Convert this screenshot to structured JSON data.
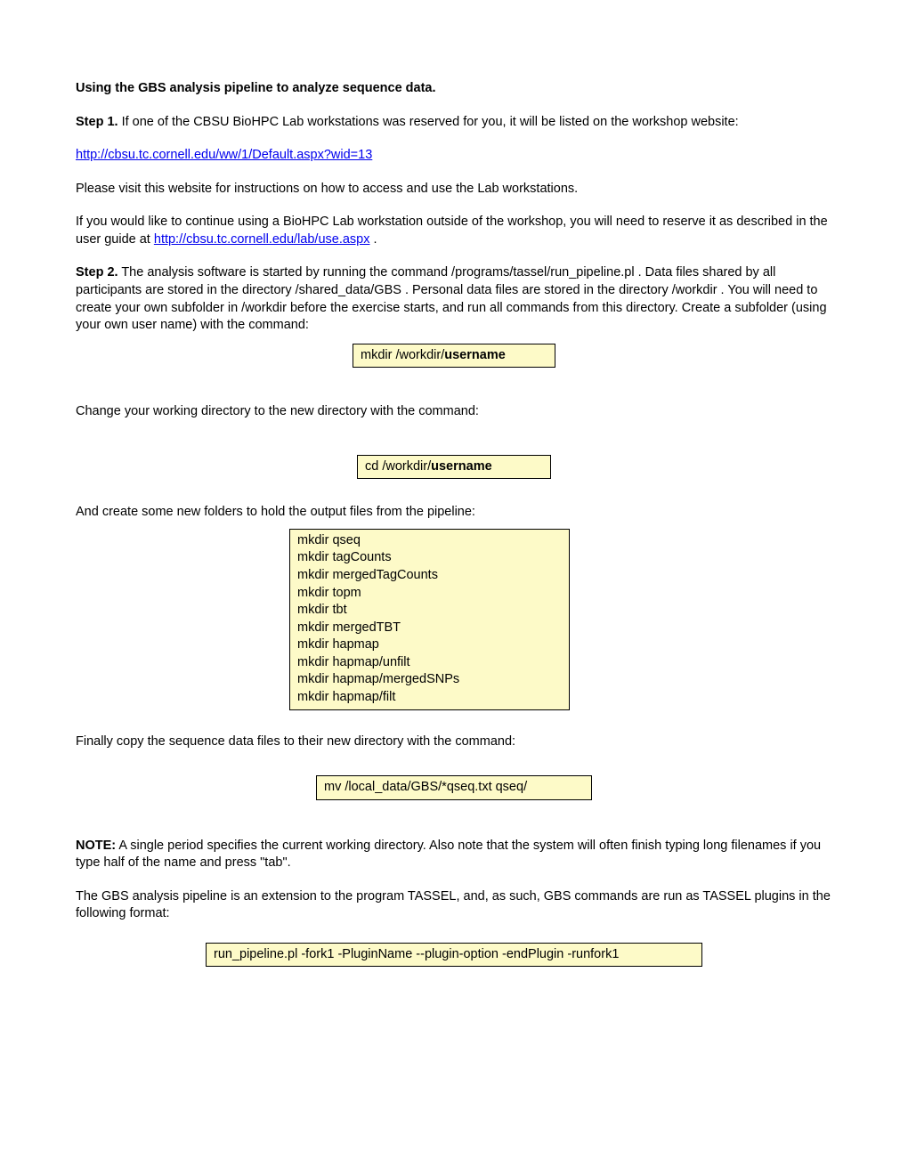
{
  "title": "Using the GBS analysis pipeline to analyze sequence data.",
  "step1_label": "Step 1.",
  "step1_tail": "  If one of the CBSU BioHPC Lab workstations was reserved for you, it will be listed on the workshop website:",
  "link1": "http://cbsu.tc.cornell.edu/ww/1/Default.aspx?wid=13",
  "visit_text": "Please visit this website for instructions on how to access and use the Lab workstations.",
  "reserve_pre": "If you would like to continue using a BioHPC Lab workstation outside of the workshop, you will need to reserve it as described in the user guide at ",
  "link2": "http://cbsu.tc.cornell.edu/lab/use.aspx",
  "reserve_post": " .",
  "step2_label": "Step 2.",
  "step2_tail": "  The analysis software is started by running the command /programs/tassel/run_pipeline.pl .  Data files shared by all participants are stored in the directory /shared_data/GBS .  Personal data files are stored in the directory /workdir .  You will need to create your own subfolder in /workdir before the exercise starts, and run all commands from this directory.  Create a subfolder (using your own user name) with the command:",
  "cmd1_pre": "mkdir /workdir/",
  "cmd1_bold": "username",
  "change_dir_text": "Change your working directory to the new directory with the command:",
  "cmd2_pre": "cd /workdir/",
  "cmd2_bold": "username",
  "create_folders_text": "And create some new folders to hold the output files from the pipeline:",
  "cmd3": "mkdir qseq\nmkdir tagCounts\nmkdir mergedTagCounts\nmkdir topm\nmkdir tbt\nmkdir mergedTBT\nmkdir hapmap\nmkdir hapmap/unfilt\nmkdir hapmap/mergedSNPs\nmkdir hapmap/filt",
  "copy_text": "Finally copy the sequence data files to their new directory with the command:",
  "cmd4": "mv /local_data/GBS/*qseq.txt qseq/",
  "note_label": "NOTE:",
  "note_tail": " A single period specifies the current working directory.  Also note that the system will often finish typing long filenames if you type half of the name and press \"tab\".",
  "tassel_text": "The GBS analysis pipeline is an extension to the program TASSEL, and, as such, GBS commands are run as TASSEL plugins in the following format:",
  "cmd5": "run_pipeline.pl -fork1 -PluginName --plugin-option -endPlugin -runfork1"
}
